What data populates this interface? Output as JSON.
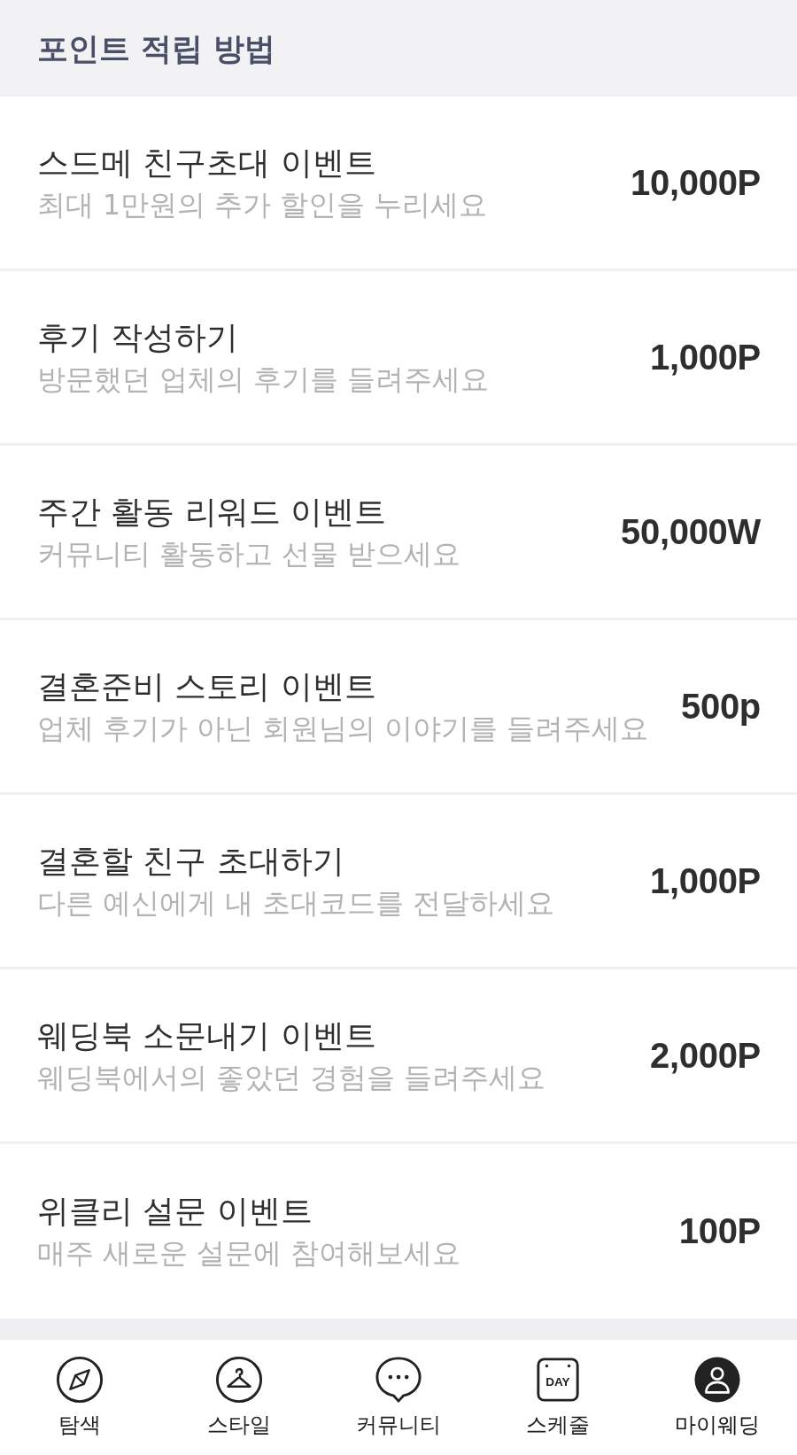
{
  "header": {
    "title": "포인트 적립 방법"
  },
  "items": [
    {
      "title": "스드메 친구초대 이벤트",
      "description": "최대 1만원의 추가 할인을 누리세요",
      "amount": "10,000P"
    },
    {
      "title": "후기 작성하기",
      "description": "방문했던 업체의 후기를 들려주세요",
      "amount": "1,000P"
    },
    {
      "title": "주간 활동 리워드 이벤트",
      "description": "커뮤니티 활동하고 선물 받으세요",
      "amount": "50,000W"
    },
    {
      "title": "결혼준비 스토리 이벤트",
      "description": "업체 후기가 아닌 회원님의 이야기를 들려주세요",
      "amount": "500p"
    },
    {
      "title": "결혼할 친구 초대하기",
      "description": "다른 예신에게 내 초대코드를 전달하세요",
      "amount": "1,000P"
    },
    {
      "title": "웨딩북 소문내기 이벤트",
      "description": "웨딩북에서의 좋았던 경험을 들려주세요",
      "amount": "2,000P"
    },
    {
      "title": "위클리 설문 이벤트",
      "description": "매주 새로운 설문에 참여해보세요",
      "amount": "100P"
    }
  ],
  "bottom_nav": [
    {
      "label": "탐색",
      "selected": false
    },
    {
      "label": "스타일",
      "selected": false
    },
    {
      "label": "커뮤니티",
      "selected": false
    },
    {
      "label": "스케줄",
      "selected": false,
      "icon_text": "DAY"
    },
    {
      "label": "마이웨딩",
      "selected": true
    }
  ]
}
